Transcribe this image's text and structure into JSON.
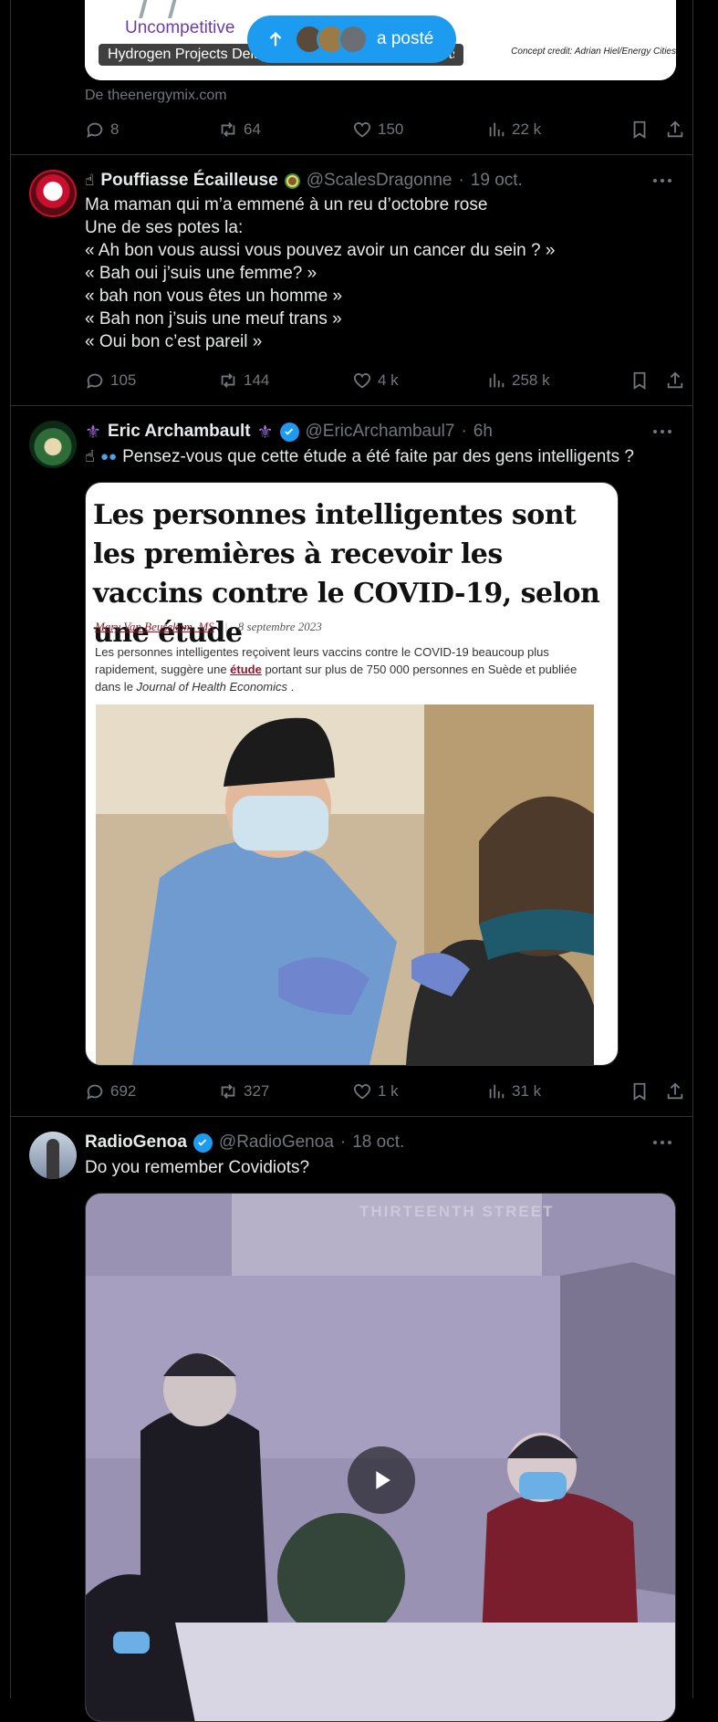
{
  "banner": {
    "label": "a posté"
  },
  "post0": {
    "card_logo_text": "Uncompetitive",
    "card_headline": "Hydrogen Projects Delayed, Cancelled as Hype Meets Reality",
    "card_credit": "Concept credit: Adrian Hiel/Energy Cities",
    "card_source": "De theenergymix.com",
    "replies": "8",
    "reposts": "64",
    "likes": "150",
    "views": "22 k"
  },
  "post1": {
    "name": "Pouffiasse Écailleuse",
    "handle": "@ScalesDragonne",
    "time": "19 oct.",
    "lines": [
      "Ma maman qui m’a emmené à un reu d’octobre rose",
      "Une de ses potes la:",
      "« Ah bon vous aussi vous pouvez avoir un cancer du sein ? »",
      "« Bah oui j’suis une femme? »",
      "« bah non vous êtes un homme »",
      "« Bah non j’suis une meuf trans »",
      "« Oui bon c’est pareil »"
    ],
    "replies": "105",
    "reposts": "144",
    "likes": "4 k",
    "views": "258 k"
  },
  "post2": {
    "name": "Eric Archambault",
    "handle": "@EricArchambaul7",
    "time": "6h",
    "text": "Pensez-vous que cette étude a été faite par des gens intelligents ?",
    "article": {
      "title": "Les personnes intelligentes sont les premières à recevoir les vaccins contre le COVID-19, selon une étude",
      "author": "Mary Van Beusekom, MS",
      "date": "8 septembre 2023",
      "body_before": "Les personnes intelligentes reçoivent leurs vaccins contre le COVID-19 beaucoup plus rapidement, suggère une ",
      "body_link": "étude",
      "body_after": " portant sur plus de 750 000 personnes en Suède et publiée dans le ",
      "body_journal": "Journal of Health Economics",
      "body_end": " ."
    },
    "replies": "692",
    "reposts": "327",
    "likes": "1 k",
    "views": "31 k"
  },
  "post3": {
    "name": "RadioGenoa",
    "handle": "@RadioGenoa",
    "time": "18 oct.",
    "text": "Do you remember Covidiots?",
    "video_sign": "THIRTEENTH STREET"
  },
  "colors": {
    "accent": "#1d9bf0",
    "muted": "#71767b",
    "background": "#000000"
  },
  "icons": [
    "reply-icon",
    "repost-icon",
    "like-icon",
    "views-icon",
    "bookmark-icon",
    "share-icon",
    "more-icon",
    "verified-icon",
    "play-icon",
    "arrow-up-icon"
  ]
}
